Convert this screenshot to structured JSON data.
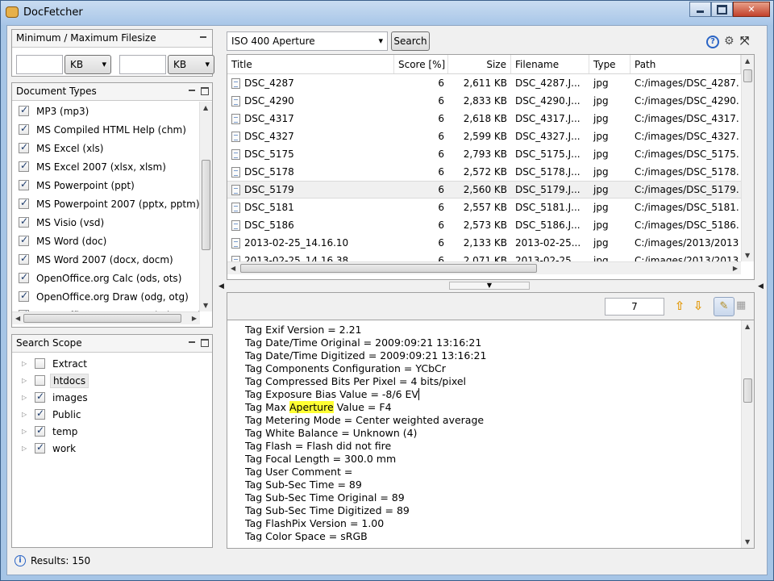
{
  "window": {
    "title": "DocFetcher"
  },
  "filesize": {
    "title": "Minimum / Maximum Filesize",
    "min_value": "",
    "min_unit": "KB",
    "max_value": "",
    "max_unit": "KB"
  },
  "doctypes": {
    "title": "Document Types",
    "items": [
      {
        "label": "MP3 (mp3)",
        "checked": true
      },
      {
        "label": "MS Compiled HTML Help (chm)",
        "checked": true
      },
      {
        "label": "MS Excel (xls)",
        "checked": true
      },
      {
        "label": "MS Excel 2007 (xlsx, xlsm)",
        "checked": true
      },
      {
        "label": "MS Powerpoint (ppt)",
        "checked": true
      },
      {
        "label": "MS Powerpoint 2007 (pptx, pptm)",
        "checked": true
      },
      {
        "label": "MS Visio (vsd)",
        "checked": true
      },
      {
        "label": "MS Word (doc)",
        "checked": true
      },
      {
        "label": "MS Word 2007 (docx, docm)",
        "checked": true
      },
      {
        "label": "OpenOffice.org Calc (ods, ots)",
        "checked": true
      },
      {
        "label": "OpenOffice.org Draw (odg, otg)",
        "checked": true
      },
      {
        "label": "OpenOffice.org Impress (odp, otp)",
        "checked": true
      }
    ]
  },
  "scope": {
    "title": "Search Scope",
    "items": [
      {
        "label": "Extract",
        "checked": false
      },
      {
        "label": "htdocs",
        "checked": false
      },
      {
        "label": "images",
        "checked": true
      },
      {
        "label": "Public",
        "checked": true
      },
      {
        "label": "temp",
        "checked": true
      },
      {
        "label": "work",
        "checked": true
      }
    ]
  },
  "search": {
    "query": "ISO 400 Aperture",
    "button_label": "Search"
  },
  "results": {
    "columns": [
      "Title",
      "Score [%]",
      "Size",
      "Filename",
      "Type",
      "Path"
    ],
    "rows": [
      {
        "title": "DSC_4287",
        "score": "6",
        "size": "2,611 KB",
        "filename": "DSC_4287.J...",
        "type": "jpg",
        "path": "C:/images/DSC_4287.",
        "selected": false
      },
      {
        "title": "DSC_4290",
        "score": "6",
        "size": "2,833 KB",
        "filename": "DSC_4290.J...",
        "type": "jpg",
        "path": "C:/images/DSC_4290.",
        "selected": false
      },
      {
        "title": "DSC_4317",
        "score": "6",
        "size": "2,618 KB",
        "filename": "DSC_4317.J...",
        "type": "jpg",
        "path": "C:/images/DSC_4317.",
        "selected": false
      },
      {
        "title": "DSC_4327",
        "score": "6",
        "size": "2,599 KB",
        "filename": "DSC_4327.J...",
        "type": "jpg",
        "path": "C:/images/DSC_4327.",
        "selected": false
      },
      {
        "title": "DSC_5175",
        "score": "6",
        "size": "2,793 KB",
        "filename": "DSC_5175.J...",
        "type": "jpg",
        "path": "C:/images/DSC_5175.",
        "selected": false
      },
      {
        "title": "DSC_5178",
        "score": "6",
        "size": "2,572 KB",
        "filename": "DSC_5178.J...",
        "type": "jpg",
        "path": "C:/images/DSC_5178.",
        "selected": false
      },
      {
        "title": "DSC_5179",
        "score": "6",
        "size": "2,560 KB",
        "filename": "DSC_5179.J...",
        "type": "jpg",
        "path": "C:/images/DSC_5179.",
        "selected": true
      },
      {
        "title": "DSC_5181",
        "score": "6",
        "size": "2,557 KB",
        "filename": "DSC_5181.J...",
        "type": "jpg",
        "path": "C:/images/DSC_5181.",
        "selected": false
      },
      {
        "title": "DSC_5186",
        "score": "6",
        "size": "2,573 KB",
        "filename": "DSC_5186.J...",
        "type": "jpg",
        "path": "C:/images/DSC_5186.",
        "selected": false
      },
      {
        "title": "2013-02-25_14.16.10",
        "score": "6",
        "size": "2,133 KB",
        "filename": "2013-02-25...",
        "type": "jpg",
        "path": "C:/images/2013/2013",
        "selected": false
      },
      {
        "title": "2013-02-25_14.16.38",
        "score": "6",
        "size": "2,071 KB",
        "filename": "2013-02-25...",
        "type": "jpg",
        "path": "C:/images/2013/2013",
        "selected": false
      }
    ]
  },
  "preview": {
    "occurrence": "7",
    "lines": [
      "Tag Exif Version = 2.21",
      "Tag Date/Time Original = 2009:09:21 13:16:21",
      "Tag Date/Time Digitized = 2009:09:21 13:16:21",
      "Tag Components Configuration = YCbCr",
      "Tag Compressed Bits Per Pixel = 4 bits/pixel",
      "Tag Exposure Bias Value = -8/6 EV",
      "Tag Max ",
      "Tag Metering Mode = Center weighted average",
      "Tag White Balance = Unknown (4)",
      "Tag Flash = Flash did not fire",
      "Tag Focal Length = 300.0 mm",
      "Tag User Comment = ",
      "Tag Sub-Sec Time = 89",
      "Tag Sub-Sec Time Original = 89",
      "Tag Sub-Sec Time Digitized = 89",
      "Tag FlashPix Version = 1.00",
      "Tag Color Space = sRGB"
    ],
    "highlight_word": "Aperture",
    "highlight_rest": " Value = F4"
  },
  "status": {
    "text": "Results: 150"
  }
}
